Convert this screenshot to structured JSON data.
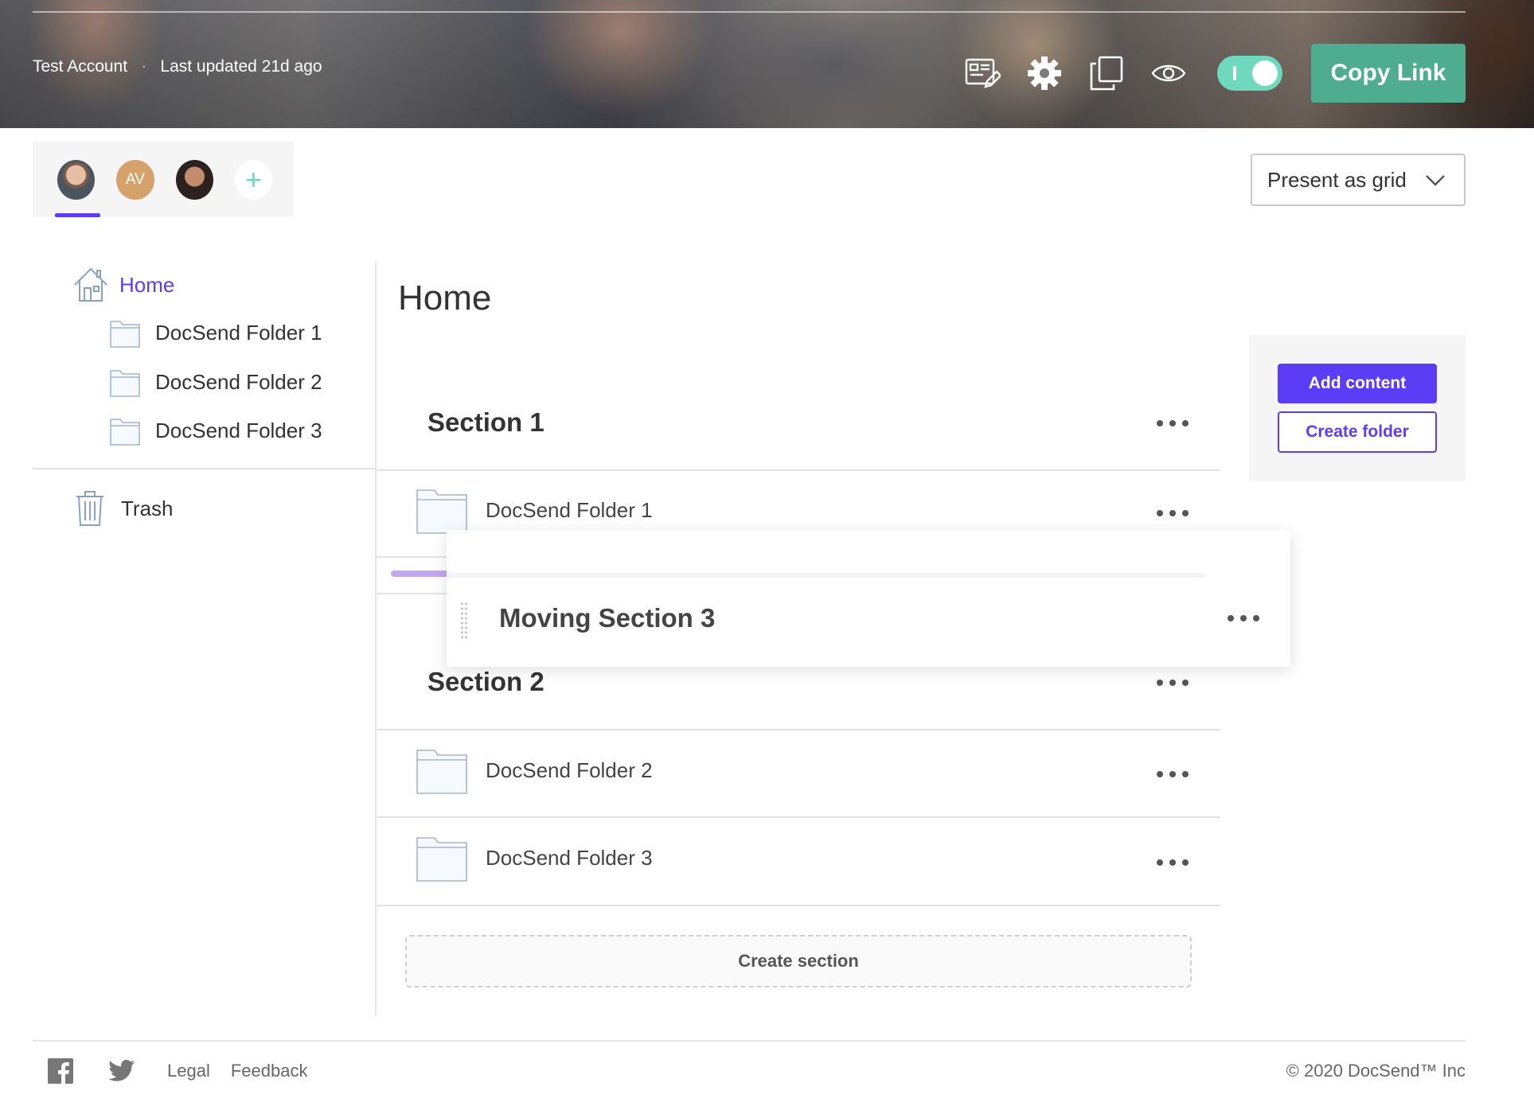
{
  "header": {
    "account": "Test Account",
    "separator": "·",
    "last_updated": "Last updated 21d ago",
    "icons": [
      "edit-details-icon",
      "gear-icon",
      "duplicate-icon",
      "eye-icon"
    ],
    "toggle_state": "on",
    "copy_link_label": "Copy Link",
    "accent_color": "#4fad8f"
  },
  "collaborators": {
    "avatars": [
      "photo",
      "AV",
      "photo"
    ],
    "initials": "AV",
    "add_symbol": "+"
  },
  "view_select": {
    "selected": "Present as grid"
  },
  "sidebar": {
    "home": "Home",
    "folders": [
      "DocSend Folder 1",
      "DocSend Folder 2",
      "DocSend Folder 3"
    ],
    "trash": "Trash"
  },
  "main": {
    "title": "Home",
    "sections": [
      {
        "title": "Section 1",
        "folders": [
          "DocSend Folder 1"
        ]
      },
      {
        "title": "Section 2",
        "folders": [
          "DocSend Folder 2",
          "DocSend Folder 3"
        ]
      }
    ],
    "dragging_section": "Moving Section 3",
    "create_section_label": "Create section"
  },
  "actions": {
    "add_content": "Add content",
    "create_folder": "Create folder",
    "primary_color": "#5b3df5"
  },
  "footer": {
    "links": [
      "Legal",
      "Feedback"
    ],
    "copyright": "© 2020 DocSend™ Inc"
  }
}
